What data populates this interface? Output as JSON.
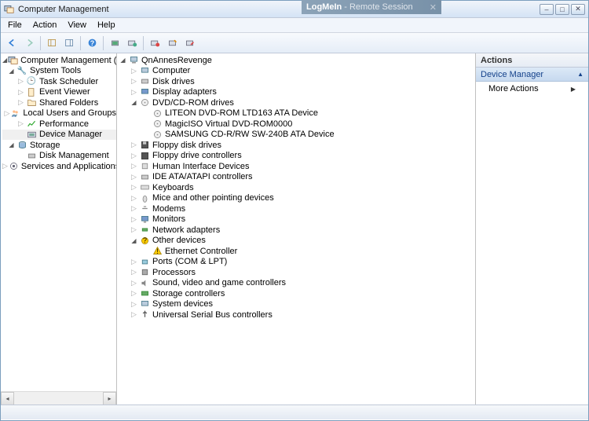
{
  "remoteSession": {
    "brand": "LogMeIn",
    "label": "- Remote Session"
  },
  "titlebar": {
    "title": "Computer Management"
  },
  "menubar": {
    "file": "File",
    "action": "Action",
    "view": "View",
    "help": "Help"
  },
  "leftTree": {
    "root": "Computer Management (Local",
    "systemTools": "System Tools",
    "taskScheduler": "Task Scheduler",
    "eventViewer": "Event Viewer",
    "sharedFolders": "Shared Folders",
    "localUsers": "Local Users and Groups",
    "performance": "Performance",
    "deviceManager": "Device Manager",
    "storage": "Storage",
    "diskManagement": "Disk Management",
    "servicesApps": "Services and Applications"
  },
  "centerTree": {
    "computerName": "QnAnnesRevenge",
    "computer": "Computer",
    "diskDrives": "Disk drives",
    "displayAdapters": "Display adapters",
    "dvdCd": "DVD/CD-ROM drives",
    "dvdCdChildren": {
      "liteon": "LITEON DVD-ROM LTD163 ATA Device",
      "magiciso": "MagicISO Virtual DVD-ROM0000",
      "samsung": "SAMSUNG CD-R/RW SW-240B ATA Device"
    },
    "floppyDrives": "Floppy disk drives",
    "floppyCtrl": "Floppy drive controllers",
    "hid": "Human Interface Devices",
    "ide": "IDE ATA/ATAPI controllers",
    "keyboards": "Keyboards",
    "mice": "Mice and other pointing devices",
    "modems": "Modems",
    "monitors": "Monitors",
    "network": "Network adapters",
    "otherDevices": "Other devices",
    "ethernetCtrl": "Ethernet Controller",
    "ports": "Ports (COM & LPT)",
    "processors": "Processors",
    "sound": "Sound, video and game controllers",
    "storageCtrl": "Storage controllers",
    "systemDevices": "System devices",
    "usb": "Universal Serial Bus controllers"
  },
  "actions": {
    "header": "Actions",
    "section": "Device Manager",
    "moreActions": "More Actions"
  }
}
